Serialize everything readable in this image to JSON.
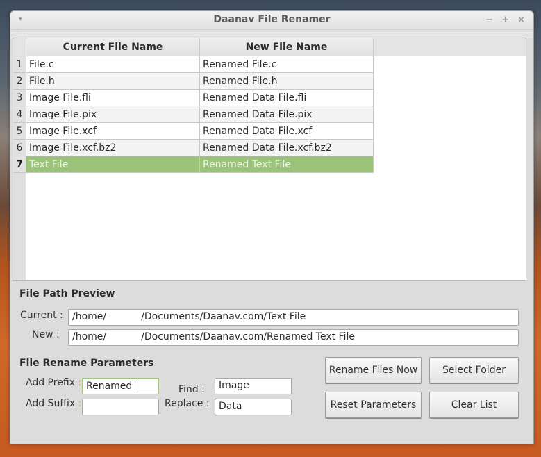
{
  "window": {
    "title": "Daanav File Renamer",
    "menu_icon": "▾",
    "controls": {
      "minimize": "−",
      "maximize": "+",
      "close": "×"
    }
  },
  "table": {
    "columns": [
      "Current File Name",
      "New File Name"
    ],
    "rows": [
      {
        "num": "1",
        "current": "File.c",
        "new": "Renamed File.c"
      },
      {
        "num": "2",
        "current": "File.h",
        "new": "Renamed File.h"
      },
      {
        "num": "3",
        "current": "Image File.fli",
        "new": "Renamed Data File.fli"
      },
      {
        "num": "4",
        "current": "Image File.pix",
        "new": "Renamed Data File.pix"
      },
      {
        "num": "5",
        "current": "Image File.xcf",
        "new": "Renamed Data File.xcf"
      },
      {
        "num": "6",
        "current": "Image File.xcf.bz2",
        "new": "Renamed Data File.xcf.bz2"
      },
      {
        "num": "7",
        "current": "Text File",
        "new": "Renamed Text File"
      }
    ],
    "selected_row": 7,
    "selection_color": "#9bc47a"
  },
  "preview": {
    "title": "File Path Preview",
    "current_label": "Current :",
    "new_label": "New :",
    "current_prefix": "/home/",
    "current_suffix": "/Documents/Daanav.com/Text File",
    "new_prefix": "/home/",
    "new_suffix": "/Documents/Daanav.com/Renamed Text File"
  },
  "params": {
    "title": "File Rename Parameters",
    "prefix_label": "Add Prefix",
    "suffix_label": "Add Suffix",
    "colon": ":",
    "find_label": "Find :",
    "replace_label": "Replace :",
    "prefix_value": "Renamed",
    "suffix_value": "",
    "find_value": "Image",
    "replace_value": "Data"
  },
  "buttons": {
    "rename": "Rename Files Now",
    "select_folder": "Select Folder",
    "reset": "Reset Parameters",
    "clear": "Clear List"
  }
}
